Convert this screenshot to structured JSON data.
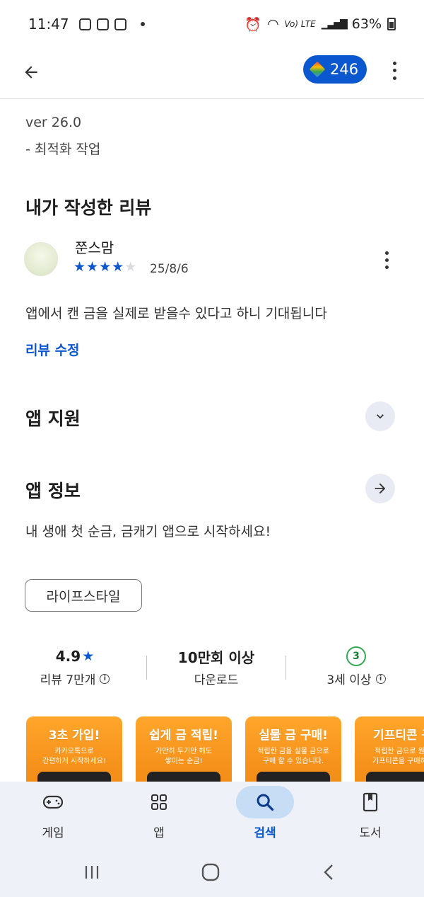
{
  "status_bar": {
    "time": "11:47",
    "network": "Vo) LTE",
    "battery": "63%"
  },
  "app_bar": {
    "points": "246",
    "icons": [
      "back-arrow-icon",
      "play-points-icon",
      "more-vert-icon"
    ]
  },
  "whats_new": {
    "version": "ver 26.0",
    "note": "- 최적화 작업"
  },
  "my_review": {
    "title": "내가 작성한 리뷰",
    "reviewer": "쭌스맘",
    "rating": 4,
    "max_rating": 5,
    "date": "25/8/6",
    "text": "앱에서 캔 금을 실제로 받을수 있다고 하니 기대됩니다",
    "edit_label": "리뷰 수정"
  },
  "app_support": {
    "title": "앱 지원"
  },
  "app_info": {
    "title": "앱 정보",
    "description": "내 생애 첫 순금, 금캐기 앱으로 시작하세요!",
    "category": "라이프스타일"
  },
  "stats": {
    "rating": "4.9",
    "rating_label": "리뷰 7만개",
    "downloads": "10만회 이상",
    "downloads_label": "다운로드",
    "age_badge": "3",
    "age_label": "3세 이상"
  },
  "screenshots": [
    {
      "title": "3초 가입!",
      "sub1": "카카오톡으로",
      "sub2": "간편하게 시작하세요!"
    },
    {
      "title": "쉽게 금 적립!",
      "sub1": "가만히 두기만 해도",
      "sub2": "쌓이는 순금!"
    },
    {
      "title": "실물 금 구매!",
      "sub1": "적립한 금을 실물 금으로",
      "sub2": "구매 할 수 있습니다."
    },
    {
      "title": "기프티콘 구",
      "sub1": "적립한 금으로 원하",
      "sub2": "기프티콘을 구매하세"
    }
  ],
  "bottom_nav": {
    "items": [
      {
        "label": "게임",
        "icon": "gamepad-icon",
        "active": false
      },
      {
        "label": "앱",
        "icon": "apps-grid-icon",
        "active": false
      },
      {
        "label": "검색",
        "icon": "search-icon",
        "active": true
      },
      {
        "label": "도서",
        "icon": "book-icon",
        "active": false
      }
    ]
  },
  "colors": {
    "accent": "#0b57d0",
    "screenshot_orange": "#f7941d",
    "nav_background": "#eef1f8",
    "age_green": "#34a853"
  }
}
